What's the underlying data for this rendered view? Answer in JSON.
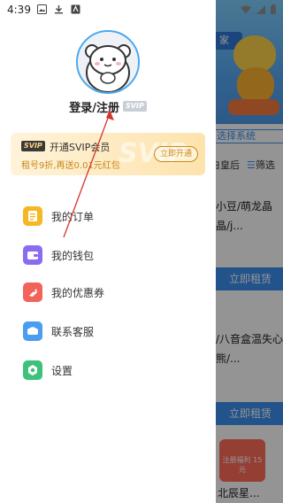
{
  "status_bar": {
    "time": "4:39"
  },
  "background": {
    "header_pill": "家",
    "select_button": "选择系统",
    "filter_left": "白皇后",
    "filter_right": "筛选",
    "card1_text": "小豆/萌龙晶晶/j...",
    "rent_label": "立即租赁",
    "card2_text": "/八音盒温失心熊/...",
    "promo_text": "注册福利 15元",
    "bottom_text": "北辰星..."
  },
  "profile": {
    "login_text": "登录/注册",
    "svip_tag": "SVIP"
  },
  "vip_card": {
    "badge": "SVIP",
    "title": "开通SVIP会员",
    "subtitle": "租号9折,再送0.01元红包",
    "button": "立即开通",
    "watermark": "SVIP"
  },
  "menu": {
    "items": [
      {
        "label": "我的订单",
        "icon": "order-icon",
        "color": "#f5b724"
      },
      {
        "label": "我的钱包",
        "icon": "wallet-icon",
        "color": "#8b6cf0"
      },
      {
        "label": "我的优惠券",
        "icon": "coupon-icon",
        "color": "#f2645a"
      },
      {
        "label": "联系客服",
        "icon": "customer-service-icon",
        "color": "#4a9df0"
      },
      {
        "label": "设置",
        "icon": "settings-icon",
        "color": "#3cc27a"
      }
    ]
  },
  "colors": {
    "accent_blue": "#4aa8ee",
    "vip_gold": "#c88a1a",
    "annotation_red": "#d6342b"
  }
}
